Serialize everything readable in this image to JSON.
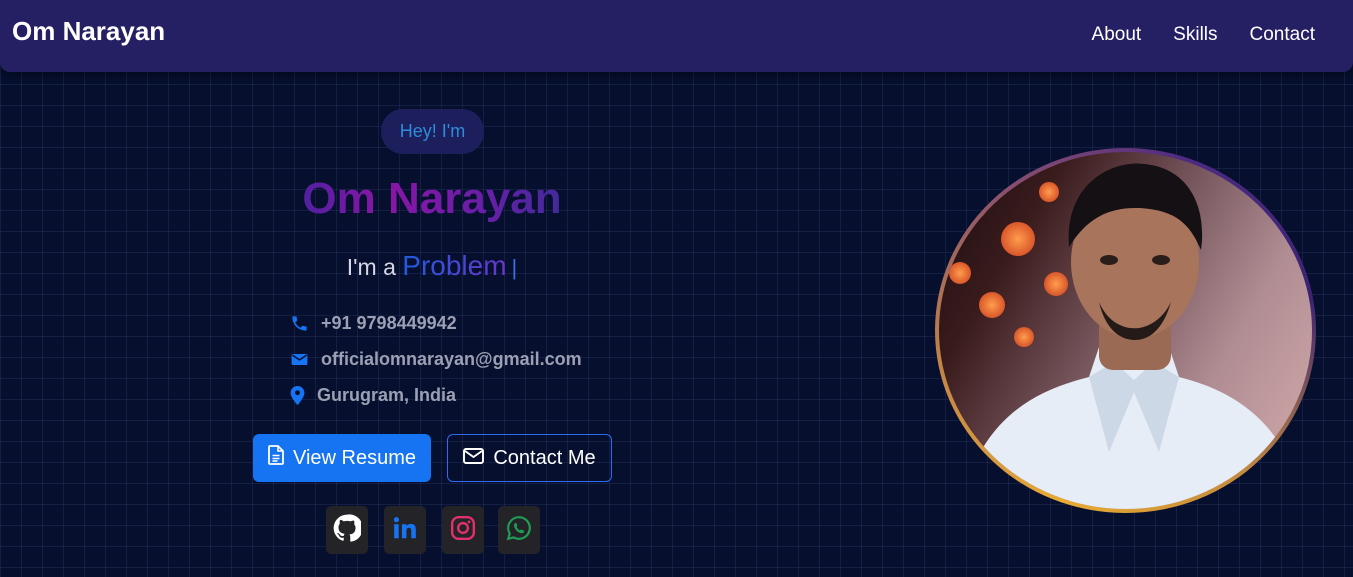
{
  "navbar": {
    "brand": "Om Narayan",
    "links": [
      "About",
      "Skills",
      "Contact"
    ]
  },
  "hero": {
    "greeting": "Hey! I'm",
    "name": "Om Narayan",
    "tagline_prefix": "I'm a",
    "tagline_typed": "Problem",
    "cursor": "|"
  },
  "contact": {
    "phone": "+91 9798449942",
    "email": "officialomnarayan@gmail.com",
    "location": "Gurugram, India"
  },
  "buttons": {
    "resume": "View Resume",
    "contact": "Contact Me"
  },
  "social": [
    "github-icon",
    "linkedin-icon",
    "instagram-icon",
    "whatsapp-icon"
  ],
  "colors": {
    "background": "#060f2e",
    "navbar": "#251f63",
    "accent_blue": "#1673f2",
    "greeting_text": "#2f8bdb"
  }
}
